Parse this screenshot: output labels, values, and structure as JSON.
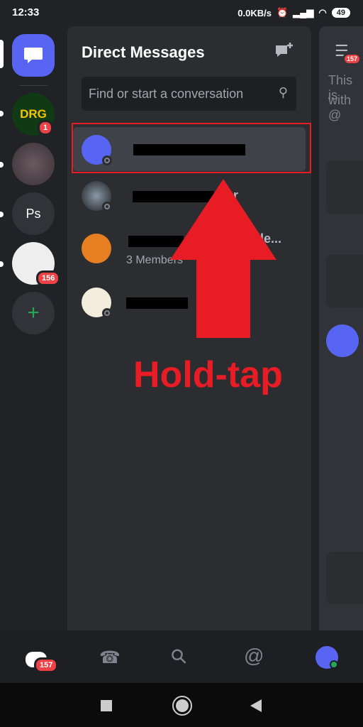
{
  "status_bar": {
    "time": "12:33",
    "net_speed": "0.0KB/s",
    "battery": "49"
  },
  "rail": {
    "servers": [
      {
        "label": "DRG",
        "badge": "1"
      },
      {
        "label": ""
      },
      {
        "label": "Ps"
      },
      {
        "label": "",
        "badge": "156"
      }
    ],
    "add_icon": "plus-icon"
  },
  "dm": {
    "title": "Direct Messages",
    "search_placeholder": "Find or start a conversation",
    "rows": [
      {
        "name_visible": ""
      },
      {
        "name_visible": "or"
      },
      {
        "name_visible": "le...",
        "subtitle": "3 Members"
      },
      {
        "name_visible": ""
      }
    ]
  },
  "right": {
    "text1": "This is",
    "text2": "with @",
    "badge": "157"
  },
  "bottom_nav": {
    "home_badge": "157"
  },
  "annotation": {
    "text": "Hold-tap",
    "color": "#e81c24"
  },
  "colors": {
    "blurple": "#5865f2",
    "red": "#ed4245",
    "green": "#23a55a"
  }
}
